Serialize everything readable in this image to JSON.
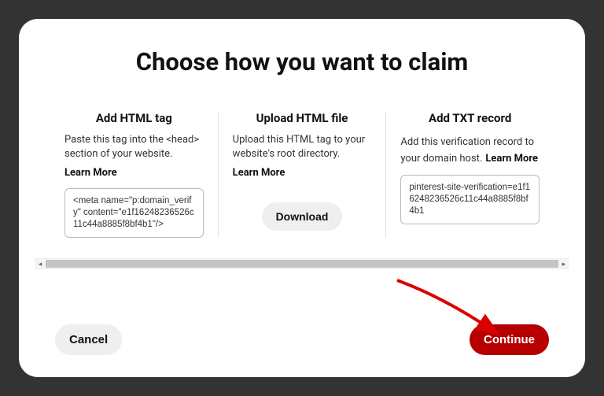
{
  "title": "Choose how you want to claim",
  "options": {
    "html_tag": {
      "title": "Add HTML tag",
      "desc": "Paste this tag into the <head> section of your website.",
      "learn_more": "Learn More",
      "code": "<meta name=\"p:domain_verify\" content=\"e1f16248236526c11c44a8885f8bf4b1\"/>"
    },
    "upload_file": {
      "title": "Upload HTML file",
      "desc": "Upload this HTML tag to your website's root directory.",
      "learn_more": "Learn More",
      "download_label": "Download"
    },
    "txt_record": {
      "title": "Add TXT record",
      "desc": "Add this verification record to your domain host.",
      "learn_more": "Learn More",
      "code": "pinterest-site-verification=e1f16248236526c11c44a8885f8bf4b1"
    }
  },
  "footer": {
    "cancel_label": "Cancel",
    "continue_label": "Continue"
  }
}
